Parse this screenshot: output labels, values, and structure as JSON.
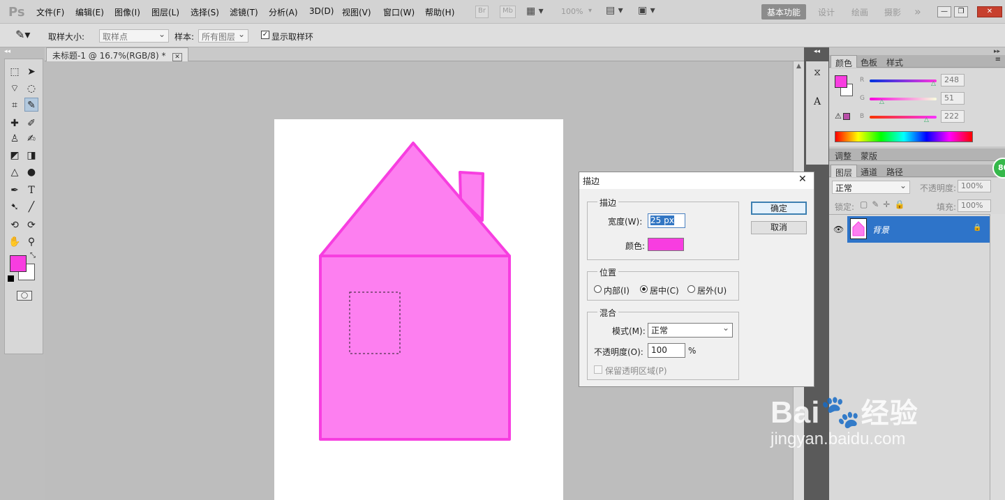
{
  "app": {
    "logo": "Ps"
  },
  "menu": [
    "文件(F)",
    "编辑(E)",
    "图像(I)",
    "图层(L)",
    "选择(S)",
    "滤镜(T)",
    "分析(A)",
    "3D(D)",
    "视图(V)",
    "窗口(W)",
    "帮助(H)"
  ],
  "menubar_tools": {
    "br": "Br",
    "mb": "Mb",
    "zoom": "100%"
  },
  "workspaces": [
    "基本功能",
    "设计",
    "绘画",
    "摄影"
  ],
  "workspaces_more": "»",
  "options": {
    "sample_size_label": "取样大小:",
    "sample_size_value": "取样点",
    "sample_label": "样本:",
    "sample_value": "所有图层",
    "show_ring_label": "显示取样环"
  },
  "document": {
    "tab_title": "未标题-1 @ 16.7%(RGB/8) *"
  },
  "colors": {
    "foreground": "#f83de0",
    "background": "#ffffff",
    "house_fill": "#fd7ff0",
    "house_stroke": "#f73ee0",
    "highlight": "#2e74c9"
  },
  "color_panel": {
    "tabs": [
      "颜色",
      "色板",
      "样式"
    ],
    "channels": [
      {
        "label": "R",
        "value": "248"
      },
      {
        "label": "G",
        "value": "51"
      },
      {
        "label": "B",
        "value": "222"
      }
    ]
  },
  "adjust_panel": {
    "tabs": [
      "调整",
      "蒙版"
    ]
  },
  "layers_panel": {
    "tabs": [
      "图层",
      "通道",
      "路径"
    ],
    "blend_mode": "正常",
    "opacity_label": "不透明度:",
    "opacity_value": "100%",
    "lock_label": "锁定:",
    "fill_label": "填充:",
    "fill_value": "100%",
    "layer_name": "背景"
  },
  "badge": "80",
  "dialog": {
    "title": "描边",
    "stroke_group": "描边",
    "width_label": "宽度(W):",
    "width_value": "25 px",
    "color_label": "颜色:",
    "position_group": "位置",
    "position_options": [
      "内部(I)",
      "居中(C)",
      "居外(U)"
    ],
    "blend_group": "混合",
    "mode_label": "模式(M):",
    "mode_value": "正常",
    "opacity_label": "不透明度(O):",
    "opacity_value": "100",
    "opacity_unit": "%",
    "preserve_label": "保留透明区域(P)",
    "ok": "确定",
    "cancel": "取消"
  },
  "watermark": {
    "brand_a": "Bai",
    "brand_b": "经验",
    "url": "jingyan.baidu.com"
  }
}
